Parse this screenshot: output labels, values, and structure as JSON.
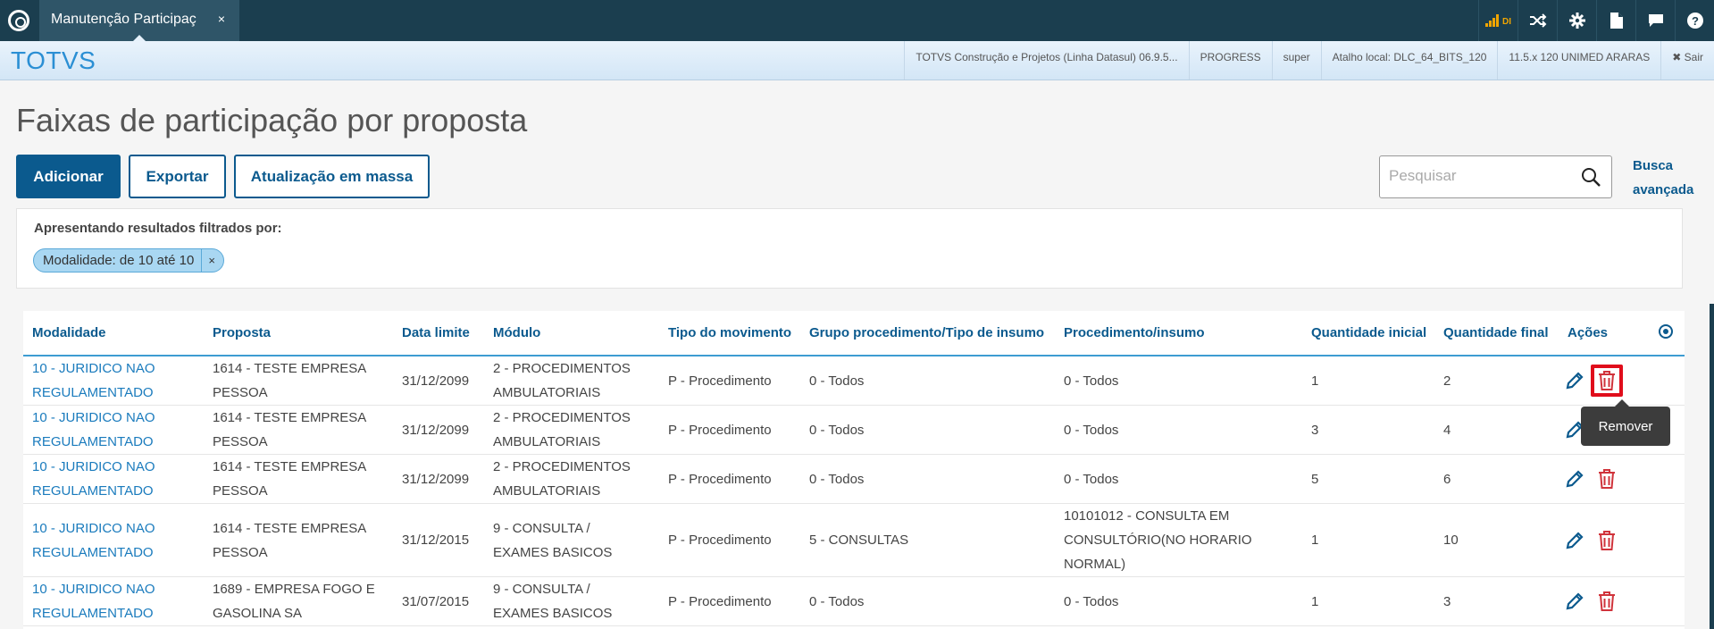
{
  "topbar": {
    "tab_title": "Manutenção Participaç",
    "tab_close": "×",
    "signal_label": "DI",
    "icons": [
      "shuffle-icon",
      "gear-icon",
      "document-icon",
      "chat-icon",
      "help-icon"
    ]
  },
  "header": {
    "brand": "TOTVS",
    "items": [
      "TOTVS Construção e Projetos (Linha Datasul) 06.9.5...",
      "PROGRESS",
      "super",
      "Atalho local: DLC_64_BITS_120",
      "11.5.x 120 UNIMED ARARAS"
    ],
    "logout": "✖ Sair"
  },
  "page": {
    "title": "Faixas de participação por proposta"
  },
  "toolbar": {
    "add_label": "Adicionar",
    "export_label": "Exportar",
    "bulk_label": "Atualização em massa"
  },
  "search": {
    "placeholder": "Pesquisar",
    "advanced_line1": "Busca",
    "advanced_line2": "avançada"
  },
  "filters": {
    "label": "Apresentando resultados filtrados por:",
    "chip": "Modalidade: de 10 até 10",
    "chip_close": "×"
  },
  "table": {
    "columns": [
      "Modalidade",
      "Proposta",
      "Data limite",
      "Módulo",
      "Tipo do movimento",
      "Grupo procedimento/Tipo de insumo",
      "Procedimento/insumo",
      "Quantidade inicial",
      "Quantidade final",
      "Ações"
    ],
    "rows": [
      {
        "modalidade": [
          "10 - JURIDICO NAO",
          "REGULAMENTADO"
        ],
        "proposta": [
          "1614 - TESTE EMPRESA",
          "PESSOA"
        ],
        "data_limite": "31/12/2099",
        "modulo": [
          "2 - PROCEDIMENTOS",
          "AMBULATORIAIS"
        ],
        "tipo": "P - Procedimento",
        "grupo": "0 - Todos",
        "procedimento": [
          "0 - Todos"
        ],
        "qtd_ini": "1",
        "qtd_fim": "2"
      },
      {
        "modalidade": [
          "10 - JURIDICO NAO",
          "REGULAMENTADO"
        ],
        "proposta": [
          "1614 - TESTE EMPRESA",
          "PESSOA"
        ],
        "data_limite": "31/12/2099",
        "modulo": [
          "2 - PROCEDIMENTOS",
          "AMBULATORIAIS"
        ],
        "tipo": "P - Procedimento",
        "grupo": "0 - Todos",
        "procedimento": [
          "0 - Todos"
        ],
        "qtd_ini": "3",
        "qtd_fim": "4"
      },
      {
        "modalidade": [
          "10 - JURIDICO NAO",
          "REGULAMENTADO"
        ],
        "proposta": [
          "1614 - TESTE EMPRESA",
          "PESSOA"
        ],
        "data_limite": "31/12/2099",
        "modulo": [
          "2 - PROCEDIMENTOS",
          "AMBULATORIAIS"
        ],
        "tipo": "P - Procedimento",
        "grupo": "0 - Todos",
        "procedimento": [
          "0 - Todos"
        ],
        "qtd_ini": "5",
        "qtd_fim": "6"
      },
      {
        "modalidade": [
          "10 - JURIDICO NAO",
          "REGULAMENTADO"
        ],
        "proposta": [
          "1614 - TESTE EMPRESA",
          "PESSOA"
        ],
        "data_limite": "31/12/2015",
        "modulo": [
          "9 - CONSULTA /",
          "EXAMES BASICOS"
        ],
        "tipo": "P - Procedimento",
        "grupo": "5 - CONSULTAS",
        "procedimento": [
          "10101012 - CONSULTA EM",
          "CONSULTÓRIO(NO HORARIO",
          "NORMAL)"
        ],
        "qtd_ini": "1",
        "qtd_fim": "10"
      },
      {
        "modalidade": [
          "10 - JURIDICO NAO",
          "REGULAMENTADO"
        ],
        "proposta": [
          "1689 - EMPRESA FOGO E",
          "GASOLINA SA"
        ],
        "data_limite": "31/07/2015",
        "modulo": [
          "9 - CONSULTA /",
          "EXAMES BASICOS"
        ],
        "tipo": "P - Procedimento",
        "grupo": "0 - Todos",
        "procedimento": [
          "0 - Todos"
        ],
        "qtd_ini": "1",
        "qtd_fim": "3"
      }
    ],
    "tooltip": "Remover"
  },
  "colors": {
    "topbar": "#1b3e4f",
    "primary": "#0b5a8e",
    "link": "#1a7bbd",
    "delete": "#d0333b",
    "highlight": "#e00d1b"
  }
}
